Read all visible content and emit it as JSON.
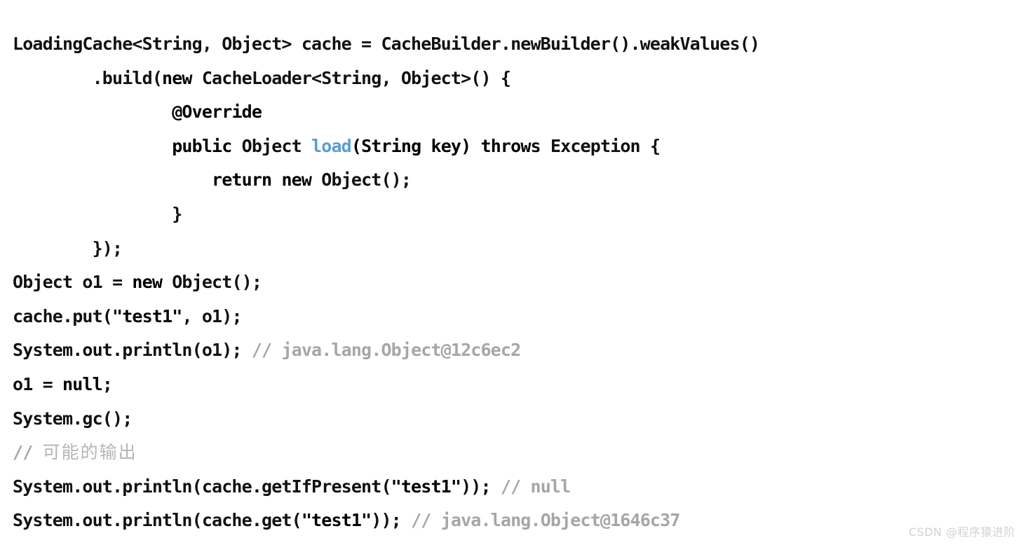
{
  "page": {
    "kind": "code-snippet-screenshot",
    "background_color": "#ffffff",
    "language": "Java"
  },
  "palette": {
    "plain": "#111111",
    "keyword": "#9f70c8",
    "annotation": "#f0922b",
    "parameter": "#f0922b",
    "method": "#5b9bd5",
    "string": "#8a9a21",
    "comment": "#a6a6a6",
    "comment_cjk": "#b5b5b5",
    "watermark": "#d2d2d2"
  },
  "code": {
    "full_text": "LoadingCache<String, Object> cache = CacheBuilder.newBuilder().weakValues()\n        .build(new CacheLoader<String, Object>() {\n            @Override\n            public Object load(String key) throws Exception {\n                return new Object();\n            }\n        });\nObject o1 = new Object();\ncache.put(\"test1\", o1);\nSystem.out.println(o1); // java.lang.Object@12c6ec2\no1 = null;\nSystem.gc();\n// 可能的输出\nSystem.out.println(cache.getIfPresent(\"test1\")); // null\nSystem.out.println(cache.get(\"test1\")); // java.lang.Object@1646c37",
    "lines": [
      {
        "n": 1,
        "tokens": [
          {
            "t": "LoadingCache<String, Object> cache = CacheBuilder.newBuilder().weakValues()",
            "c": "plain"
          }
        ]
      },
      {
        "n": 2,
        "tokens": [
          {
            "t": "        .build(",
            "c": "plain"
          },
          {
            "t": "new",
            "c": "keyword"
          },
          {
            "t": " CacheLoader<String, Object>() {",
            "c": "plain"
          }
        ]
      },
      {
        "n": 3,
        "tokens": [
          {
            "t": "                ",
            "c": "plain"
          },
          {
            "t": "@Override",
            "c": "annotation"
          }
        ]
      },
      {
        "n": 4,
        "tokens": [
          {
            "t": "                ",
            "c": "plain"
          },
          {
            "t": "public",
            "c": "keyword"
          },
          {
            "t": " ",
            "c": "plain"
          },
          {
            "t": "Object",
            "c": "type"
          },
          {
            "t": " ",
            "c": "plain"
          },
          {
            "t": "load",
            "c": "method"
          },
          {
            "t": "(",
            "c": "parameter"
          },
          {
            "t": "String key",
            "c": "parameter"
          },
          {
            "t": ")",
            "c": "parameter"
          },
          {
            "t": " ",
            "c": "plain"
          },
          {
            "t": "throws",
            "c": "keyword"
          },
          {
            "t": " ",
            "c": "plain"
          },
          {
            "t": "Exception {",
            "c": "type"
          }
        ]
      },
      {
        "n": 5,
        "tokens": [
          {
            "t": "                    ",
            "c": "plain"
          },
          {
            "t": "return",
            "c": "keyword"
          },
          {
            "t": " ",
            "c": "plain"
          },
          {
            "t": "new",
            "c": "keyword"
          },
          {
            "t": " ",
            "c": "plain"
          },
          {
            "t": "Object();",
            "c": "plain"
          }
        ]
      },
      {
        "n": 6,
        "tokens": [
          {
            "t": "                }",
            "c": "plain"
          }
        ]
      },
      {
        "n": 7,
        "tokens": [
          {
            "t": "        });",
            "c": "plain"
          }
        ]
      },
      {
        "n": 8,
        "tokens": [
          {
            "t": "Object o1 = ",
            "c": "plain"
          },
          {
            "t": "new",
            "c": "keyword"
          },
          {
            "t": " Object();",
            "c": "plain"
          }
        ]
      },
      {
        "n": 9,
        "tokens": [
          {
            "t": "cache.put(",
            "c": "plain"
          },
          {
            "t": "\"test1\"",
            "c": "string"
          },
          {
            "t": ", o1);",
            "c": "plain"
          }
        ]
      },
      {
        "n": 10,
        "tokens": [
          {
            "t": "System.out.println(o1); ",
            "c": "plain"
          },
          {
            "t": "// java.lang.Object@12c6ec2",
            "c": "comment"
          }
        ]
      },
      {
        "n": 11,
        "tokens": [
          {
            "t": "o1 = ",
            "c": "plain"
          },
          {
            "t": "null",
            "c": "keyword"
          },
          {
            "t": ";",
            "c": "plain"
          }
        ]
      },
      {
        "n": 12,
        "tokens": [
          {
            "t": "System.gc();",
            "c": "plain"
          }
        ]
      },
      {
        "n": 13,
        "tokens": [
          {
            "t": "// ",
            "c": "comment"
          },
          {
            "t": "可能的输出",
            "c": "comment_cjk"
          }
        ]
      },
      {
        "n": 14,
        "tokens": [
          {
            "t": "System.out.println(cache.getIfPresent(",
            "c": "plain"
          },
          {
            "t": "\"test1\"",
            "c": "string"
          },
          {
            "t": ")); ",
            "c": "plain"
          },
          {
            "t": "// null",
            "c": "comment"
          }
        ]
      },
      {
        "n": 15,
        "tokens": [
          {
            "t": "System.out.println(cache.get(",
            "c": "plain"
          },
          {
            "t": "\"test1\"",
            "c": "string"
          },
          {
            "t": ")); ",
            "c": "plain"
          },
          {
            "t": "// java.lang.Object@1646c37",
            "c": "comment"
          }
        ]
      }
    ]
  },
  "watermark": {
    "text": "CSDN @程序猿进阶"
  }
}
